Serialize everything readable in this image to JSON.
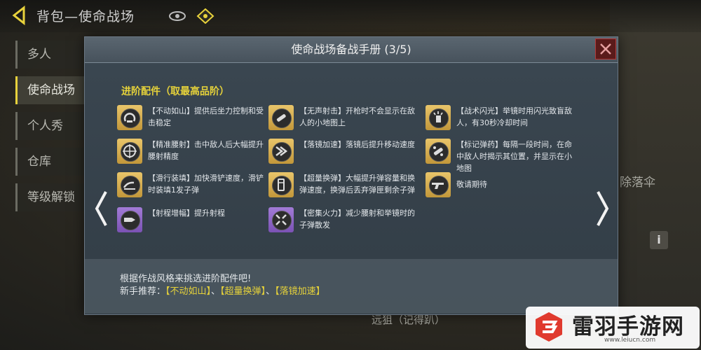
{
  "page": {
    "title": "背包—使命战场"
  },
  "side_menu": [
    {
      "label": "多人",
      "active": false
    },
    {
      "label": "使命战场",
      "active": true
    },
    {
      "label": "个人秀",
      "active": false
    },
    {
      "label": "仓库",
      "active": false
    },
    {
      "label": "等级解锁",
      "active": false
    }
  ],
  "background": {
    "right_label": "除落伞",
    "info_label": "i",
    "bottom_label": "远狙（记得趴）"
  },
  "modal": {
    "title": "使命战场备战手册 (3/5)",
    "section_title": "进阶配件（取最高品阶）",
    "perks": [
      {
        "text": "【不动如山】提供后坐力控制和受击稳定",
        "icon": "stance-icon",
        "tier": "gold"
      },
      {
        "text": "【无声射击】开枪时不会显示在敌人的小地图上",
        "icon": "silencer-icon",
        "tier": "gold"
      },
      {
        "text": "【战术闪光】举镜时用闪光致盲敌人，有30秒冷却时间",
        "icon": "flash-icon",
        "tier": "gold"
      },
      {
        "text": "【精准腰射】击中敌人后大幅提升腰射精度",
        "icon": "crosshair-icon",
        "tier": "gold"
      },
      {
        "text": "【落镜加速】落镜后提升移动速度",
        "icon": "speed-icon",
        "tier": "gold"
      },
      {
        "text": "【标记弹药】每隔一段时间，在命中敌人时揭示其位置，并显示在小地图",
        "icon": "tracker-icon",
        "tier": "gold"
      },
      {
        "text": "【滑行装填】加快滑铲速度，滑铲时装填1发子弹",
        "icon": "slide-icon",
        "tier": "gold"
      },
      {
        "text": "【超量换弹】大幅提升弹容量和换弹速度，换弹后丢弃弹匣剩余子弹",
        "icon": "magazine-icon",
        "tier": "gold"
      },
      {
        "text": "敬请期待",
        "icon": "gun-icon",
        "tier": "gold"
      },
      {
        "text": "【射程增幅】提升射程",
        "icon": "bullet-icon",
        "tier": "purple"
      },
      {
        "text": "【密集火力】减少腰射和举镜时的子弹散发",
        "icon": "spread-icon",
        "tier": "purple"
      }
    ],
    "tip_line1": "根据作战风格来挑选进阶配件吧!",
    "tip_prefix": "新手推荐：",
    "tip_rec1": "【不动如山】",
    "tip_sep1": "、",
    "tip_rec2": "【超量换弹】",
    "tip_sep2": "、",
    "tip_rec3": "【落镜加速】"
  },
  "watermark": {
    "name": "雷羽手游网",
    "url": "www.leiucn.com"
  },
  "colors": {
    "accent_yellow": "#e6d23a",
    "gold_tier": "#d6ad4e",
    "purple_tier": "#8e64c6",
    "close_red": "#b23a3a"
  }
}
